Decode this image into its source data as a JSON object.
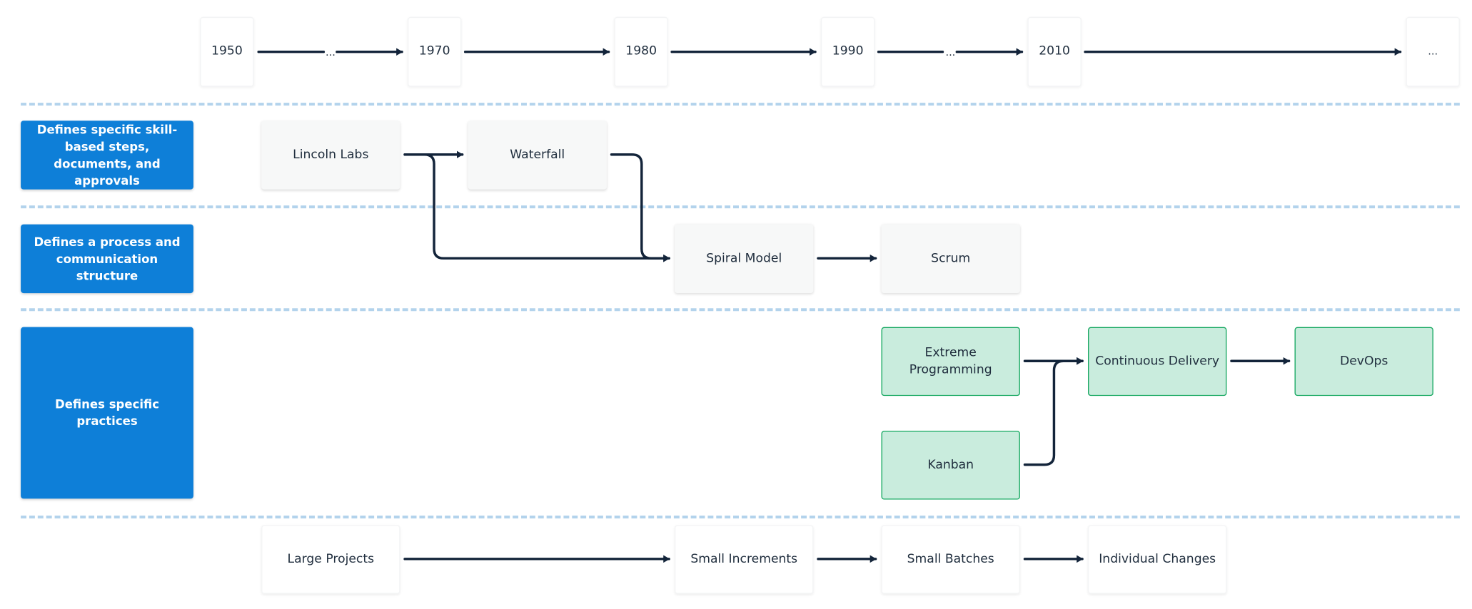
{
  "timeline": {
    "years": [
      "1950",
      "1970",
      "1980",
      "1990",
      "2010",
      "..."
    ],
    "gap_markers": [
      "...",
      "..."
    ]
  },
  "rows": [
    {
      "label": "Defines specific skill-based steps, documents, and approvals"
    },
    {
      "label": "Defines a process and communication structure"
    },
    {
      "label": "Defines specific practices"
    }
  ],
  "nodes": {
    "lincoln_labs": "Lincoln Labs",
    "waterfall": "Waterfall",
    "spiral_model": "Spiral Model",
    "scrum": "Scrum",
    "extreme_programming": "Extreme Programming",
    "kanban": "Kanban",
    "continuous_delivery": "Continuous Delivery",
    "devops": "DevOps"
  },
  "scale_row": [
    "Large Projects",
    "Small Increments",
    "Small Batches",
    "Individual Changes"
  ],
  "edges": [
    [
      "1950",
      "1970"
    ],
    [
      "1970",
      "1980"
    ],
    [
      "1980",
      "1990"
    ],
    [
      "1990",
      "2010"
    ],
    [
      "2010",
      "..."
    ],
    [
      "Lincoln Labs",
      "Waterfall"
    ],
    [
      "Lincoln Labs",
      "Spiral Model"
    ],
    [
      "Waterfall",
      "Spiral Model"
    ],
    [
      "Spiral Model",
      "Scrum"
    ],
    [
      "Extreme Programming",
      "Continuous Delivery"
    ],
    [
      "Kanban",
      "Continuous Delivery"
    ],
    [
      "Continuous Delivery",
      "DevOps"
    ],
    [
      "Large Projects",
      "Small Increments"
    ],
    [
      "Small Increments",
      "Small Batches"
    ],
    [
      "Small Batches",
      "Individual Changes"
    ]
  ],
  "colors": {
    "row_label_bg": "#0e7fd8",
    "practice_node_bg": "#c9ecdd",
    "practice_node_border": "#12a65e",
    "edge": "#13243a",
    "divider": "#b3d3ec"
  }
}
